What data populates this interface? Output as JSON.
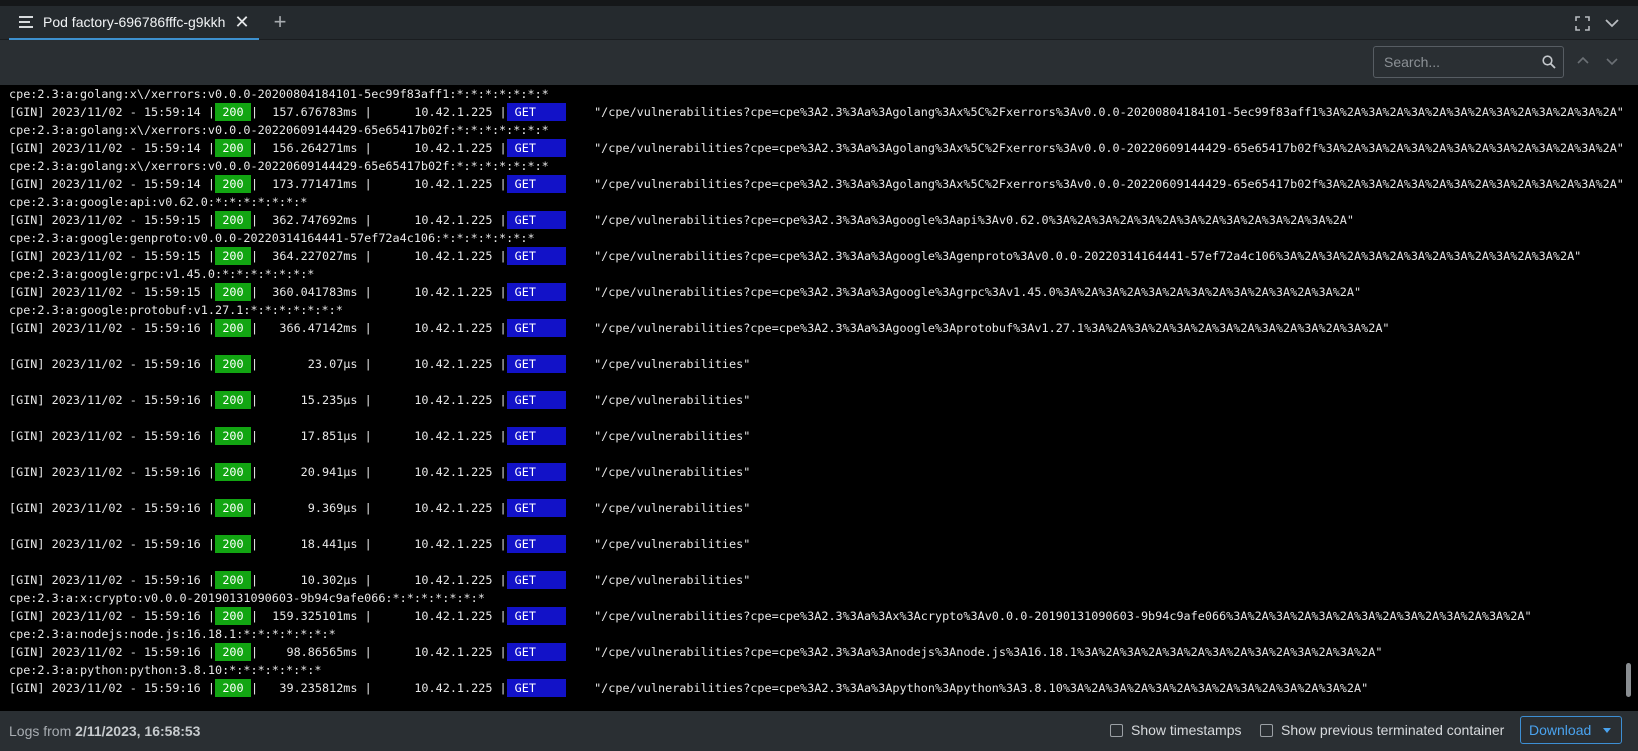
{
  "tab": {
    "title": "Pod factory-696786fffc-g9kkh",
    "close_glyph": "✕",
    "new_glyph": "+"
  },
  "toolbar": {
    "search_placeholder": "Search..."
  },
  "log": {
    "lines": [
      "cpe:2.3:a:golang:x\\/xerrors:v0.0.0-20200804184101-5ec99f83aff1:*:*:*:*:*:*:*",
      {
        "prefix": "[GIN] 2023/11/02 - 15:59:14 |",
        "status": "200",
        "mid": "|  157.676783ms |      10.42.1.225 |",
        "method": "GET",
        "path": "    \"/cpe/vulnerabilities?cpe=cpe%3A2.3%3Aa%3Agolang%3Ax%5C%2Fxerrors%3Av0.0.0-20200804184101-5ec99f83aff1%3A%2A%3A%2A%3A%2A%3A%2A%3A%2A%3A%2A%3A%2A\""
      },
      "cpe:2.3:a:golang:x\\/xerrors:v0.0.0-20220609144429-65e65417b02f:*:*:*:*:*:*:*",
      {
        "prefix": "[GIN] 2023/11/02 - 15:59:14 |",
        "status": "200",
        "mid": "|  156.264271ms |      10.42.1.225 |",
        "method": "GET",
        "path": "    \"/cpe/vulnerabilities?cpe=cpe%3A2.3%3Aa%3Agolang%3Ax%5C%2Fxerrors%3Av0.0.0-20220609144429-65e65417b02f%3A%2A%3A%2A%3A%2A%3A%2A%3A%2A%3A%2A%3A%2A\""
      },
      "cpe:2.3:a:golang:x\\/xerrors:v0.0.0-20220609144429-65e65417b02f:*:*:*:*:*:*:*",
      {
        "prefix": "[GIN] 2023/11/02 - 15:59:14 |",
        "status": "200",
        "mid": "|  173.771471ms |      10.42.1.225 |",
        "method": "GET",
        "path": "    \"/cpe/vulnerabilities?cpe=cpe%3A2.3%3Aa%3Agolang%3Ax%5C%2Fxerrors%3Av0.0.0-20220609144429-65e65417b02f%3A%2A%3A%2A%3A%2A%3A%2A%3A%2A%3A%2A%3A%2A\""
      },
      "cpe:2.3:a:google:api:v0.62.0:*:*:*:*:*:*:*",
      {
        "prefix": "[GIN] 2023/11/02 - 15:59:15 |",
        "status": "200",
        "mid": "|  362.747692ms |      10.42.1.225 |",
        "method": "GET",
        "path": "    \"/cpe/vulnerabilities?cpe=cpe%3A2.3%3Aa%3Agoogle%3Aapi%3Av0.62.0%3A%2A%3A%2A%3A%2A%3A%2A%3A%2A%3A%2A%3A%2A\""
      },
      "cpe:2.3:a:google:genproto:v0.0.0-20220314164441-57ef72a4c106:*:*:*:*:*:*:*",
      {
        "prefix": "[GIN] 2023/11/02 - 15:59:15 |",
        "status": "200",
        "mid": "|  364.227027ms |      10.42.1.225 |",
        "method": "GET",
        "path": "    \"/cpe/vulnerabilities?cpe=cpe%3A2.3%3Aa%3Agoogle%3Agenproto%3Av0.0.0-20220314164441-57ef72a4c106%3A%2A%3A%2A%3A%2A%3A%2A%3A%2A%3A%2A%3A%2A\""
      },
      "cpe:2.3:a:google:grpc:v1.45.0:*:*:*:*:*:*:*",
      {
        "prefix": "[GIN] 2023/11/02 - 15:59:15 |",
        "status": "200",
        "mid": "|  360.041783ms |      10.42.1.225 |",
        "method": "GET",
        "path": "    \"/cpe/vulnerabilities?cpe=cpe%3A2.3%3Aa%3Agoogle%3Agrpc%3Av1.45.0%3A%2A%3A%2A%3A%2A%3A%2A%3A%2A%3A%2A%3A%2A\""
      },
      "cpe:2.3:a:google:protobuf:v1.27.1:*:*:*:*:*:*:*",
      {
        "prefix": "[GIN] 2023/11/02 - 15:59:16 |",
        "status": "200",
        "mid": "|   366.47142ms |      10.42.1.225 |",
        "method": "GET",
        "path": "    \"/cpe/vulnerabilities?cpe=cpe%3A2.3%3Aa%3Agoogle%3Aprotobuf%3Av1.27.1%3A%2A%3A%2A%3A%2A%3A%2A%3A%2A%3A%2A%3A%2A\""
      },
      "",
      {
        "prefix": "[GIN] 2023/11/02 - 15:59:16 |",
        "status": "200",
        "mid": "|       23.07µs |      10.42.1.225 |",
        "method": "GET",
        "path": "    \"/cpe/vulnerabilities\""
      },
      "",
      {
        "prefix": "[GIN] 2023/11/02 - 15:59:16 |",
        "status": "200",
        "mid": "|      15.235µs |      10.42.1.225 |",
        "method": "GET",
        "path": "    \"/cpe/vulnerabilities\""
      },
      "",
      {
        "prefix": "[GIN] 2023/11/02 - 15:59:16 |",
        "status": "200",
        "mid": "|      17.851µs |      10.42.1.225 |",
        "method": "GET",
        "path": "    \"/cpe/vulnerabilities\""
      },
      "",
      {
        "prefix": "[GIN] 2023/11/02 - 15:59:16 |",
        "status": "200",
        "mid": "|      20.941µs |      10.42.1.225 |",
        "method": "GET",
        "path": "    \"/cpe/vulnerabilities\""
      },
      "",
      {
        "prefix": "[GIN] 2023/11/02 - 15:59:16 |",
        "status": "200",
        "mid": "|       9.369µs |      10.42.1.225 |",
        "method": "GET",
        "path": "    \"/cpe/vulnerabilities\""
      },
      "",
      {
        "prefix": "[GIN] 2023/11/02 - 15:59:16 |",
        "status": "200",
        "mid": "|      18.441µs |      10.42.1.225 |",
        "method": "GET",
        "path": "    \"/cpe/vulnerabilities\""
      },
      "",
      {
        "prefix": "[GIN] 2023/11/02 - 15:59:16 |",
        "status": "200",
        "mid": "|      10.302µs |      10.42.1.225 |",
        "method": "GET",
        "path": "    \"/cpe/vulnerabilities\""
      },
      "cpe:2.3:a:x:crypto:v0.0.0-20190131090603-9b94c9afe066:*:*:*:*:*:*:*",
      {
        "prefix": "[GIN] 2023/11/02 - 15:59:16 |",
        "status": "200",
        "mid": "|  159.325101ms |      10.42.1.225 |",
        "method": "GET",
        "path": "    \"/cpe/vulnerabilities?cpe=cpe%3A2.3%3Aa%3Ax%3Acrypto%3Av0.0.0-20190131090603-9b94c9afe066%3A%2A%3A%2A%3A%2A%3A%2A%3A%2A%3A%2A%3A%2A\""
      },
      "cpe:2.3:a:nodejs:node.js:16.18.1:*:*:*:*:*:*:*",
      {
        "prefix": "[GIN] 2023/11/02 - 15:59:16 |",
        "status": "200",
        "mid": "|    98.86565ms |      10.42.1.225 |",
        "method": "GET",
        "path": "    \"/cpe/vulnerabilities?cpe=cpe%3A2.3%3Aa%3Anodejs%3Anode.js%3A16.18.1%3A%2A%3A%2A%3A%2A%3A%2A%3A%2A%3A%2A%3A%2A\""
      },
      "cpe:2.3:a:python:python:3.8.10:*:*:*:*:*:*:*",
      {
        "prefix": "[GIN] 2023/11/02 - 15:59:16 |",
        "status": "200",
        "mid": "|   39.235812ms |      10.42.1.225 |",
        "method": "GET",
        "path": "    \"/cpe/vulnerabilities?cpe=cpe%3A2.3%3Aa%3Apython%3Apython%3A3.8.10%3A%2A%3A%2A%3A%2A%3A%2A%3A%2A%3A%2A%3A%2A\""
      }
    ]
  },
  "footer": {
    "logs_from_label": "Logs from ",
    "logs_from_value": "2/11/2023, 16:58:53",
    "show_timestamps": "Show timestamps",
    "show_previous": "Show previous terminated container",
    "download": "Download"
  },
  "colors": {
    "status_ok": "#12a512",
    "method": "#1212c8",
    "accent": "#3d90ce"
  }
}
